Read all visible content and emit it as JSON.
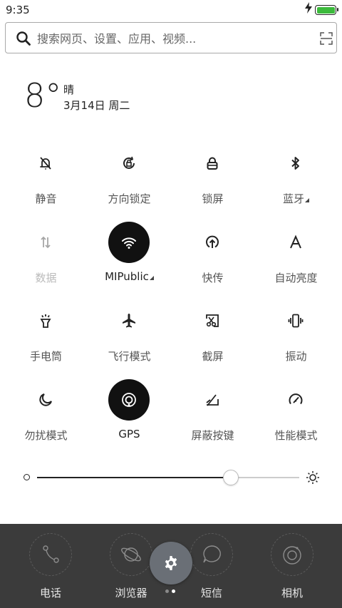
{
  "status_bar": {
    "time": "9:35",
    "battery_level": 1.0,
    "battery_color": "#3cba3c",
    "charging_icon": "bolt-icon"
  },
  "search": {
    "placeholder": "搜索网页、设置、应用、视频...",
    "value": ""
  },
  "weather": {
    "temperature": "8°",
    "condition": "晴",
    "date": "3月14日 周二"
  },
  "toggles": [
    {
      "label": "静音",
      "icon": "bell-off-icon",
      "active": false
    },
    {
      "label": "方向锁定",
      "icon": "rotation-lock-icon",
      "active": false
    },
    {
      "label": "锁屏",
      "icon": "lock-icon",
      "active": false
    },
    {
      "label": "蓝牙",
      "icon": "bluetooth-icon",
      "active": false,
      "expandable": true
    },
    {
      "label": "数据",
      "icon": "mobile-data-icon",
      "active": false,
      "disabled": true
    },
    {
      "label": "MIPublic",
      "icon": "wifi-icon",
      "active": true,
      "expandable": true
    },
    {
      "label": "快传",
      "icon": "quick-transfer-icon",
      "active": false
    },
    {
      "label": "自动亮度",
      "icon": "auto-brightness-icon",
      "active": false
    },
    {
      "label": "手电筒",
      "icon": "flashlight-icon",
      "active": false
    },
    {
      "label": "飞行模式",
      "icon": "airplane-icon",
      "active": false
    },
    {
      "label": "截屏",
      "icon": "screenshot-icon",
      "active": false
    },
    {
      "label": "振动",
      "icon": "vibrate-icon",
      "active": false
    },
    {
      "label": "勿扰模式",
      "icon": "moon-icon",
      "active": false
    },
    {
      "label": "GPS",
      "icon": "gps-icon",
      "active": true
    },
    {
      "label": "屏蔽按键",
      "icon": "block-keys-icon",
      "active": false
    },
    {
      "label": "性能模式",
      "icon": "speedometer-icon",
      "active": false
    }
  ],
  "brightness": {
    "level": 0.74
  },
  "dock": {
    "apps": [
      {
        "label": "电话",
        "icon": "phone-icon"
      },
      {
        "label": "浏览器",
        "icon": "browser-planet-icon"
      },
      {
        "label": "短信",
        "icon": "message-bubble-icon"
      },
      {
        "label": "相机",
        "icon": "camera-icon"
      }
    ],
    "settings_icon": "gear-icon",
    "page_count": 2,
    "current_page": 2
  }
}
